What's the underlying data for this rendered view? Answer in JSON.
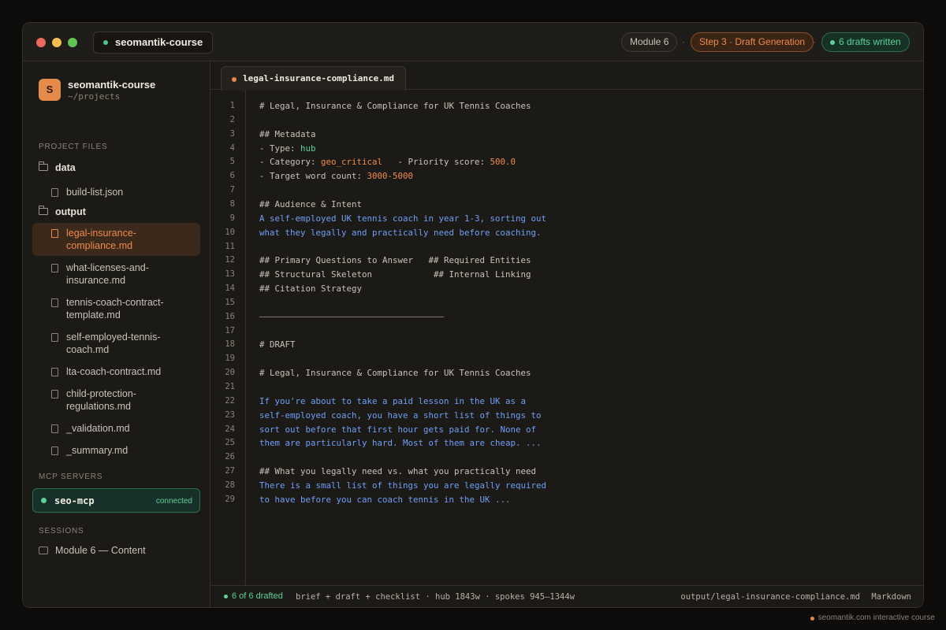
{
  "titlebar": {
    "project": "seomantik-course",
    "module": "Module 6",
    "step": "Step 3 · Draft Generation",
    "drafts": "6 drafts written",
    "separator": "·"
  },
  "sidebar": {
    "avatar_letter": "S",
    "project_name": "seomantik-course",
    "project_path": "~/projects",
    "files_label": "PROJECT FILES",
    "folders": [
      "data",
      "output"
    ],
    "data_files": [
      "build-list.json"
    ],
    "output_files": [
      "legal-insurance-compliance.md",
      "what-licenses-and-insurance.md",
      "tennis-coach-contract-template.md",
      "self-employed-tennis-coach.md",
      "lta-coach-contract.md",
      "child-protection-regulations.md",
      "_validation.md",
      "_summary.md"
    ],
    "mcp_label": "MCP SERVERS",
    "mcp_name": "seo-mcp",
    "mcp_status": "connected",
    "sessions_label": "SESSIONS",
    "session": "Module 6 — Content"
  },
  "editor": {
    "tab": "legal-insurance-compliance.md",
    "lines": [
      [
        [
          "# Legal, Insurance & Compliance for UK Tennis Coaches",
          "h"
        ]
      ],
      [],
      [
        [
          "## Metadata",
          "h"
        ]
      ],
      [
        [
          "- Type: ",
          "h"
        ],
        [
          "hub",
          "g"
        ]
      ],
      [
        [
          "- Category: ",
          "h"
        ],
        [
          "geo_critical",
          "o"
        ],
        [
          "   - Priority score: ",
          "h"
        ],
        [
          "500.0",
          "o"
        ]
      ],
      [
        [
          "- Target word count: ",
          "h"
        ],
        [
          "3000-5000",
          "o"
        ]
      ],
      [],
      [
        [
          "## Audience & Intent",
          "h"
        ]
      ],
      [
        [
          "A self-employed UK tennis coach in year 1-3, sorting out",
          "b"
        ]
      ],
      [
        [
          "what they legally and practically need before coaching.",
          "b"
        ]
      ],
      [],
      [
        [
          "## Primary Questions to Answer   ## Required Entities",
          "h"
        ]
      ],
      [
        [
          "## Structural Skeleton            ## Internal Linking",
          "h"
        ]
      ],
      [
        [
          "## Citation Strategy",
          "h"
        ]
      ],
      [],
      [
        [
          "────────────────────────────────────",
          "d"
        ]
      ],
      [],
      [
        [
          "# DRAFT",
          "h"
        ]
      ],
      [],
      [
        [
          "# Legal, Insurance & Compliance for UK Tennis Coaches",
          "h"
        ]
      ],
      [],
      [
        [
          "If you're about to take a paid lesson in the UK as a",
          "b"
        ]
      ],
      [
        [
          "self-employed coach, you have a short list of things to",
          "b"
        ]
      ],
      [
        [
          "sort out before that first hour gets paid for. None of",
          "b"
        ]
      ],
      [
        [
          "them are particularly hard. Most of them are cheap. ...",
          "b"
        ]
      ],
      [],
      [
        [
          "## What you legally need vs. what you practically need",
          "h"
        ]
      ],
      [
        [
          "There is a small list of things you are legally required",
          "b"
        ]
      ],
      [
        [
          "to have before you can coach tennis in the UK ...",
          "b"
        ]
      ]
    ]
  },
  "statusbar": {
    "drafted": "6 of 6 drafted",
    "info": "brief + draft + checklist · hub 1843w · spokes 945–1344w",
    "path": "output/legal-insurance-compliance.md",
    "language": "Markdown"
  },
  "footer": "seomantik.com interactive course",
  "colors": {
    "accent_orange": "#f08a4b",
    "accent_green": "#5fd195",
    "code_blue": "#6f9ff5",
    "background": "#1c1a17"
  }
}
